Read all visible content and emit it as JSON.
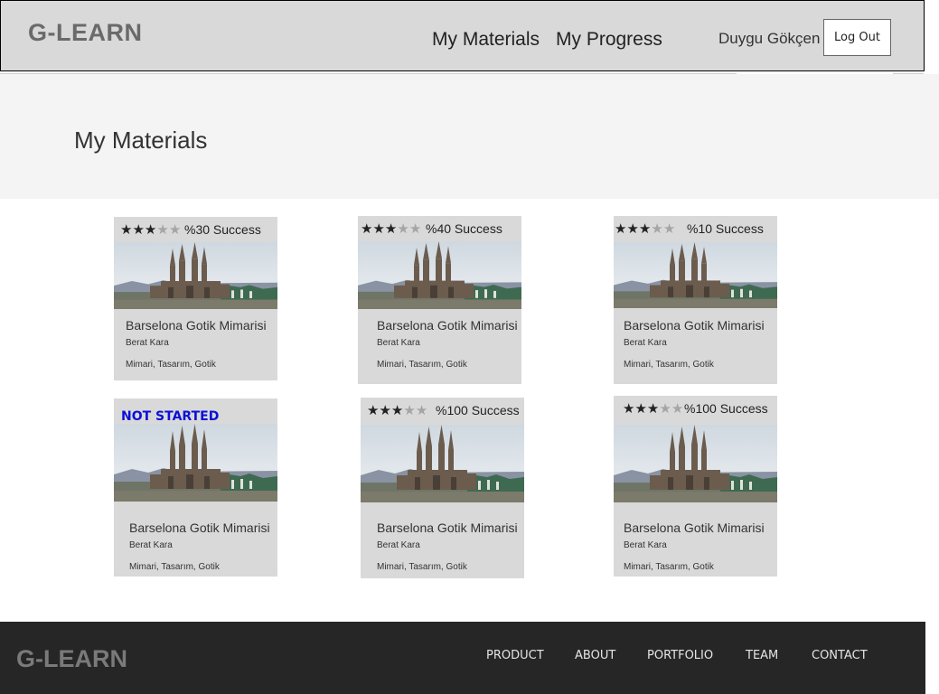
{
  "header": {
    "logo": "G-LEARN",
    "nav": [
      "My Materials",
      "My Progress"
    ],
    "user_name": "Duygu Gökçen",
    "logout_label": "Log Out"
  },
  "page": {
    "title": "My Materials"
  },
  "cards": [
    {
      "status": "started",
      "rating": 3,
      "max_rating": 5,
      "success_text": "%30 Success",
      "title": "Barselona Gotik Mimarisi",
      "author": "Berat Kara",
      "tags": "Mimari, Tasarım, Gotik"
    },
    {
      "status": "started",
      "rating": 3,
      "max_rating": 5,
      "success_text": "%40 Success",
      "title": "Barselona Gotik Mimarisi",
      "author": "Berat Kara",
      "tags": "Mimari, Tasarım, Gotik"
    },
    {
      "status": "started",
      "rating": 3,
      "max_rating": 5,
      "success_text": "%10 Success",
      "title": "Barselona Gotik Mimarisi",
      "author": "Berat Kara",
      "tags": "Mimari, Tasarım, Gotik"
    },
    {
      "status": "not_started",
      "status_text": "NOT STARTED",
      "title": "Barselona Gotik Mimarisi",
      "author": "Berat Kara",
      "tags": "Mimari, Tasarım, Gotik"
    },
    {
      "status": "started",
      "rating": 3,
      "max_rating": 5,
      "success_text": "%100 Success",
      "title": "Barselona Gotik Mimarisi",
      "author": "Berat Kara",
      "tags": "Mimari, Tasarım, Gotik"
    },
    {
      "status": "started",
      "rating": 3,
      "max_rating": 5,
      "success_text": "%100 Success",
      "title": "Barselona Gotik Mimarisi",
      "author": "Berat Kara",
      "tags": "Mimari, Tasarım, Gotik"
    }
  ],
  "footer": {
    "logo": "G-LEARN",
    "links": [
      "PRODUCT",
      "ABOUT",
      "PORTFOLIO",
      "TEAM",
      "CONTACT"
    ]
  },
  "colors": {
    "header_bg": "#d9d9d9",
    "card_bg": "#d9d9d9",
    "footer_bg": "#262626",
    "not_started": "#0a10d8"
  }
}
